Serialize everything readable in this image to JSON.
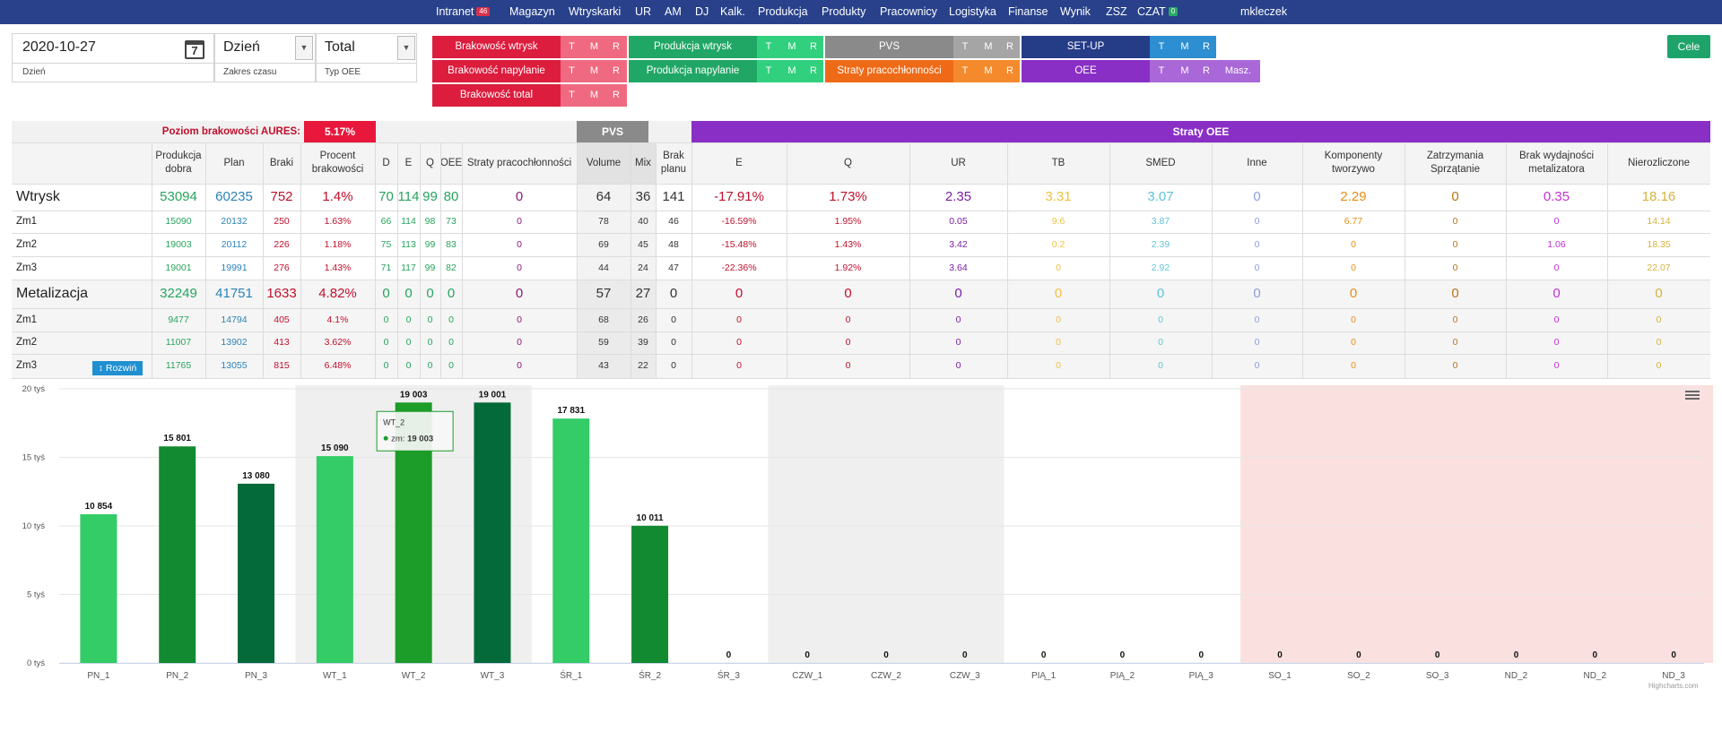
{
  "nav": {
    "items": [
      "Intranet",
      "Magazyn",
      "Wtryskarki",
      "UR",
      "AM",
      "DJ",
      "Kalk.",
      "Produkcja",
      "Produkty",
      "Pracownicy",
      "Logistyka",
      "Finanse",
      "Wynik",
      "ZSZ",
      "CZAT"
    ],
    "intranet_badge": "46",
    "czat_badge": "0",
    "user": "mkleczek"
  },
  "filters": {
    "date_value": "2020-10-27",
    "date_label": "Dzień",
    "range_value": "Dzień",
    "range_label": "Zakres czasu",
    "oee_value": "Total",
    "oee_label": "Typ OEE"
  },
  "metrics": {
    "sub_tmr": [
      "T",
      "M",
      "R"
    ],
    "masz": "Masz.",
    "brak_wtrysk": "Brakowość wtrysk",
    "brak_napylanie": "Brakowość napylanie",
    "brak_total": "Brakowość total",
    "prod_wtrysk": "Produkcja wtrysk",
    "prod_napylanie": "Produkcja napylanie",
    "pvs": "PVS",
    "straty_prac": "Straty pracochłonności",
    "setup": "SET-UP",
    "oee": "OEE",
    "cele": "Cele"
  },
  "table": {
    "poziom_label": "Poziom brakowości AURES:",
    "poziom_value": "5.17%",
    "pvs_group": "PVS",
    "straty_group": "Straty OEE",
    "headers": [
      "Produkcja dobra",
      "Plan",
      "Braki",
      "Procent brakowości",
      "D",
      "E",
      "Q",
      "OEE",
      "Straty pracochłonności",
      "Volume",
      "Mix",
      "Brak planu",
      "E",
      "Q",
      "UR",
      "TB",
      "SMED",
      "Inne",
      "Komponenty tworzywo",
      "Zatrzymania Sprzątanie",
      "Brak wydajności metalizatora",
      "Nierozliczone"
    ],
    "rows": [
      {
        "label": "Wtrysk",
        "values": [
          "53094",
          "60235",
          "752",
          "1.4%",
          "70",
          "114",
          "99",
          "80",
          "0",
          "64",
          "36",
          "141",
          "-17.91%",
          "1.73%",
          "2.35",
          "3.31",
          "3.07",
          "0",
          "2.29",
          "0",
          "0.35",
          "18.16"
        ]
      },
      {
        "label": "Zm1",
        "values": [
          "15090",
          "20132",
          "250",
          "1.63%",
          "66",
          "114",
          "98",
          "73",
          "0",
          "78",
          "40",
          "46",
          "-16.59%",
          "1.95%",
          "0.05",
          "9.6",
          "3.87",
          "0",
          "6.77",
          "0",
          "0",
          "14.14"
        ]
      },
      {
        "label": "Zm2",
        "values": [
          "19003",
          "20112",
          "226",
          "1.18%",
          "75",
          "113",
          "99",
          "83",
          "0",
          "69",
          "45",
          "48",
          "-15.48%",
          "1.43%",
          "3.42",
          "0.2",
          "2.39",
          "0",
          "0",
          "0",
          "1.06",
          "18.35"
        ]
      },
      {
        "label": "Zm3",
        "values": [
          "19001",
          "19991",
          "276",
          "1.43%",
          "71",
          "117",
          "99",
          "82",
          "0",
          "44",
          "24",
          "47",
          "-22.36%",
          "1.92%",
          "3.64",
          "0",
          "2.92",
          "0",
          "0",
          "0",
          "0",
          "22.07"
        ]
      },
      {
        "label": "Metalizacja",
        "values": [
          "32249",
          "41751",
          "1633",
          "4.82%",
          "0",
          "0",
          "0",
          "0",
          "0",
          "57",
          "27",
          "0",
          "0",
          "0",
          "0",
          "0",
          "0",
          "0",
          "0",
          "0",
          "0",
          "0"
        ]
      },
      {
        "label": "Zm1",
        "values": [
          "9477",
          "14794",
          "405",
          "4.1%",
          "0",
          "0",
          "0",
          "0",
          "0",
          "68",
          "26",
          "0",
          "0",
          "0",
          "0",
          "0",
          "0",
          "0",
          "0",
          "0",
          "0",
          "0"
        ]
      },
      {
        "label": "Zm2",
        "values": [
          "11007",
          "13902",
          "413",
          "3.62%",
          "0",
          "0",
          "0",
          "0",
          "0",
          "59",
          "39",
          "0",
          "0",
          "0",
          "0",
          "0",
          "0",
          "0",
          "0",
          "0",
          "0",
          "0"
        ]
      },
      {
        "label": "Zm3",
        "values": [
          "11765",
          "13055",
          "815",
          "6.48%",
          "0",
          "0",
          "0",
          "0",
          "0",
          "43",
          "22",
          "0",
          "0",
          "0",
          "0",
          "0",
          "0",
          "0",
          "0",
          "0",
          "0",
          "0"
        ]
      }
    ],
    "rozwin": "↕ Rozwiń",
    "column_colors": [
      "#27a45d",
      "#2b83b5",
      "#c0102c",
      "#c0102c",
      "#27a45d",
      "#27a45d",
      "#27a45d",
      "#27a45d",
      "#8b1a7a",
      "#333333",
      "#333333",
      "#333333",
      "#c0102c",
      "#c0102c",
      "#7b1fa2",
      "#f2c040",
      "#5ec3d6",
      "#8c9ee0",
      "#e88d15",
      "#b8741a",
      "#c330d6",
      "#d6b23d"
    ]
  },
  "chart_data": {
    "type": "bar",
    "categories": [
      "PN_1",
      "PN_2",
      "PN_3",
      "WT_1",
      "WT_2",
      "WT_3",
      "ŚR_1",
      "ŚR_2",
      "ŚR_3",
      "CZW_1",
      "CZW_2",
      "CZW_3",
      "PIĄ_1",
      "PIĄ_2",
      "PIĄ_3",
      "SO_1",
      "SO_2",
      "SO_3",
      "ND_2",
      "ND_2",
      "ND_3"
    ],
    "values": [
      10854,
      15801,
      13080,
      15090,
      19003,
      19001,
      17831,
      10011,
      0,
      0,
      0,
      0,
      0,
      0,
      0,
      0,
      0,
      0,
      0,
      0,
      0
    ],
    "data_labels": [
      "10 854",
      "15 801",
      "13 080",
      "15 090",
      "19 003",
      "19 001",
      "17 831",
      "10 011",
      "0",
      "0",
      "0",
      "0",
      "0",
      "0",
      "0",
      "0",
      "0",
      "0",
      "0",
      "0",
      "0"
    ],
    "bar_colors": [
      "#33cc66",
      "#128a32",
      "#046a3a",
      "#33cc66",
      "#1c9c28",
      "#046a3a",
      "#33cc66",
      "#128a32"
    ],
    "band_colors": [
      "#ffffff",
      "#efefef",
      "#ffffff",
      "#efefef",
      "#ffffff",
      "#fbe0e0"
    ],
    "y_ticks": [
      "0 tyś",
      "5 tyś",
      "10 tyś",
      "15 tyś",
      "20 tyś"
    ],
    "ylim": [
      0,
      20000
    ],
    "grid": true,
    "tooltip": {
      "title": "WT_2",
      "series": "zm:",
      "value": "19 003"
    },
    "credit": "Highcharts.com"
  }
}
